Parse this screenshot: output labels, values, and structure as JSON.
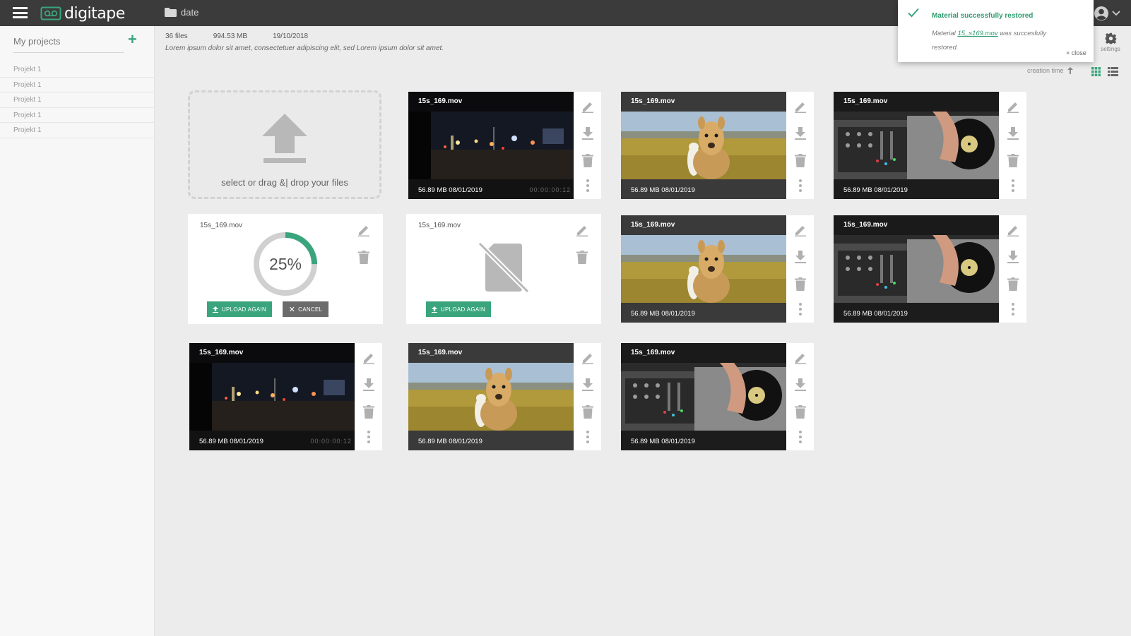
{
  "header": {
    "app_name": "digitape",
    "breadcrumb": "date"
  },
  "sidebar": {
    "title": "My projects",
    "add_label": "+",
    "items": [
      {
        "label": "Projekt 1"
      },
      {
        "label": "Projekt 1"
      },
      {
        "label": "Projekt 1"
      },
      {
        "label": "Projekt 1"
      },
      {
        "label": "Projekt 1"
      }
    ]
  },
  "info": {
    "file_count": "36 files",
    "size": "994.53 MB",
    "date": "19/10/2018",
    "description": "Lorem ipsum dolor sit amet, consectetuer adipiscing elit, sed Lorem ipsum dolor sit amet."
  },
  "toolbar": {
    "settings_label": "settings",
    "sort_label": "creation time"
  },
  "notification": {
    "title": "Material successfully restored",
    "body_prefix": "Material",
    "body_link": "15_s169.mov",
    "body_suffix": "was succesfully restored.",
    "close_label": "× close"
  },
  "upload": {
    "dropzone_text": "select or drag &| drop your files",
    "progress_card": {
      "filename": "15s_169.mov",
      "percent_label": "25%",
      "progress": 0.25,
      "upload_again": "UPLOAD AGAIN",
      "cancel": "CANCEL"
    },
    "failed_card": {
      "filename": "15s_169.mov",
      "upload_again": "UPLOAD AGAIN"
    }
  },
  "files": [
    {
      "name": "15s_169.mov",
      "meta": "56.89 MB   08/01/2019",
      "timecode": "00:00:00:12",
      "scene": "night"
    },
    {
      "name": "15s_169.mov",
      "meta": "56.89 MB   08/01/2019",
      "scene": "alpaca"
    },
    {
      "name": "15s_169.mov",
      "meta": "56.89 MB   08/01/2019",
      "scene": "dj"
    },
    {
      "name": "15s_169.mov",
      "meta": "56.89 MB   08/01/2019",
      "scene": "alpaca"
    },
    {
      "name": "15s_169.mov",
      "meta": "56.89 MB   08/01/2019",
      "scene": "dj"
    },
    {
      "name": "15s_169.mov",
      "meta": "56.89 MB   08/01/2019",
      "timecode": "00:00:00:12",
      "scene": "night"
    },
    {
      "name": "15s_169.mov",
      "meta": "56.89 MB   08/01/2019",
      "scene": "alpaca"
    },
    {
      "name": "15s_169.mov",
      "meta": "56.89 MB   08/01/2019",
      "scene": "dj"
    }
  ],
  "colors": {
    "accent": "#3aa57d",
    "topbar": "#3b3b3b",
    "background": "#ececec"
  }
}
